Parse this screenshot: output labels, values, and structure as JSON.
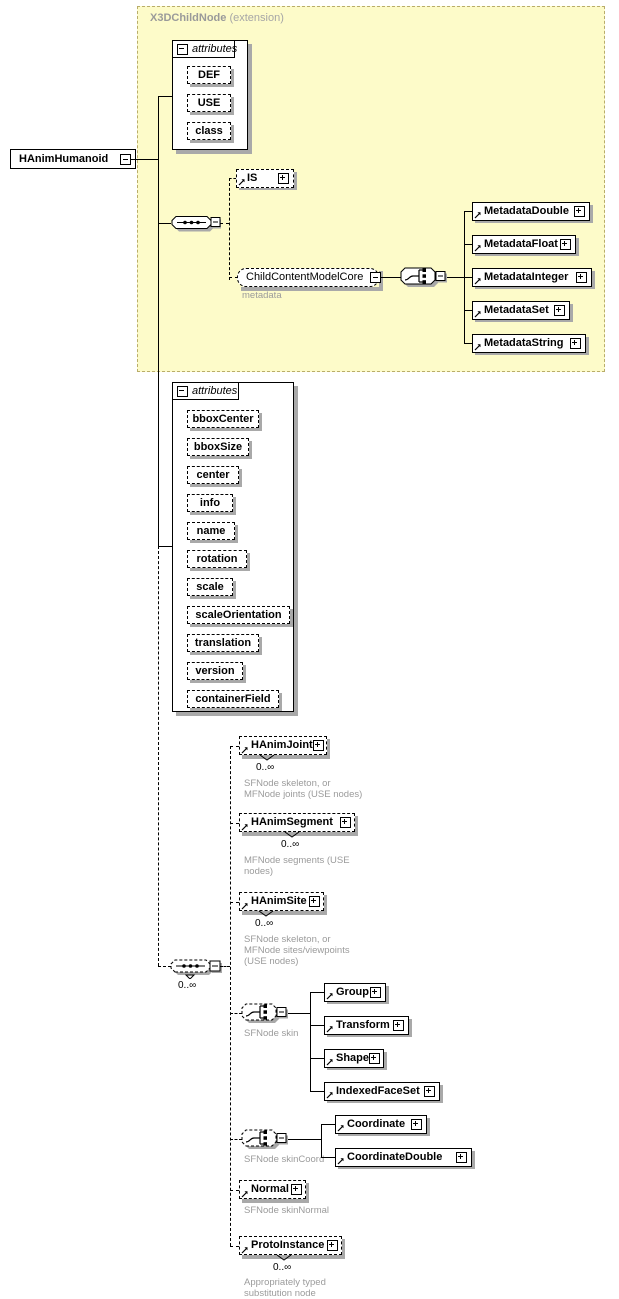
{
  "diagram": {
    "type": "xml-schema-diagram",
    "root_element": "HAnimHumanoid",
    "extension": {
      "base_name": "X3DChildNode",
      "qualifier": "(extension)",
      "background_color": "#fdfbc9",
      "border_color": "#b9ad6a"
    }
  },
  "root": {
    "label": "HAnimHumanoid"
  },
  "base_attributes": {
    "header_label": "attributes",
    "items": [
      {
        "label": "DEF"
      },
      {
        "label": "USE"
      },
      {
        "label": "class"
      }
    ]
  },
  "base_children": {
    "compositor": "sequence",
    "is_node": {
      "label": "IS"
    },
    "group_ref": {
      "label": "ChildContentModelCore",
      "annotation": "metadata"
    },
    "choice_compositor": "choice",
    "metadata_nodes": [
      {
        "label": "MetadataDouble"
      },
      {
        "label": "MetadataFloat"
      },
      {
        "label": "MetadataInteger"
      },
      {
        "label": "MetadataSet"
      },
      {
        "label": "MetadataString"
      }
    ]
  },
  "own_attributes": {
    "header_label": "attributes",
    "items": [
      {
        "label": "bboxCenter"
      },
      {
        "label": "bboxSize"
      },
      {
        "label": "center"
      },
      {
        "label": "info"
      },
      {
        "label": "name"
      },
      {
        "label": "rotation"
      },
      {
        "label": "scale"
      },
      {
        "label": "scaleOrientation"
      },
      {
        "label": "translation"
      },
      {
        "label": "version"
      },
      {
        "label": "containerField"
      }
    ]
  },
  "own_children": {
    "compositor": "sequence",
    "compositor_cardinality": "0..∞",
    "hanim_nodes": [
      {
        "label": "HAnimJoint",
        "cardinality": "0..∞",
        "annotation": "SFNode skeleton, or\nMFNode joints (USE nodes)"
      },
      {
        "label": "HAnimSegment",
        "cardinality": "0..∞",
        "annotation": "MFNode segments (USE\nnodes)"
      },
      {
        "label": "HAnimSite",
        "cardinality": "0..∞",
        "annotation": "SFNode skeleton, or\nMFNode sites/viewpoints\n(USE nodes)"
      }
    ],
    "skin_choice": {
      "annotation": "SFNode skin",
      "options": [
        {
          "label": "Group"
        },
        {
          "label": "Transform"
        },
        {
          "label": "Shape"
        },
        {
          "label": "IndexedFaceSet"
        }
      ]
    },
    "skin_coord_choice": {
      "annotation": "SFNode skinCoord",
      "options": [
        {
          "label": "Coordinate"
        },
        {
          "label": "CoordinateDouble"
        }
      ]
    },
    "normal_node": {
      "label": "Normal",
      "annotation": "SFNode skinNormal"
    },
    "proto_instance": {
      "label": "ProtoInstance",
      "cardinality": "0..∞",
      "annotation": "Appropriately typed\nsubstitution node"
    }
  },
  "colors": {
    "extension_fill": "#fdfbc9",
    "extension_border": "#b9ad6a",
    "node_text": "#000000",
    "annotation_text": "#9b9b9b",
    "shadow": "#a9a9a9"
  }
}
